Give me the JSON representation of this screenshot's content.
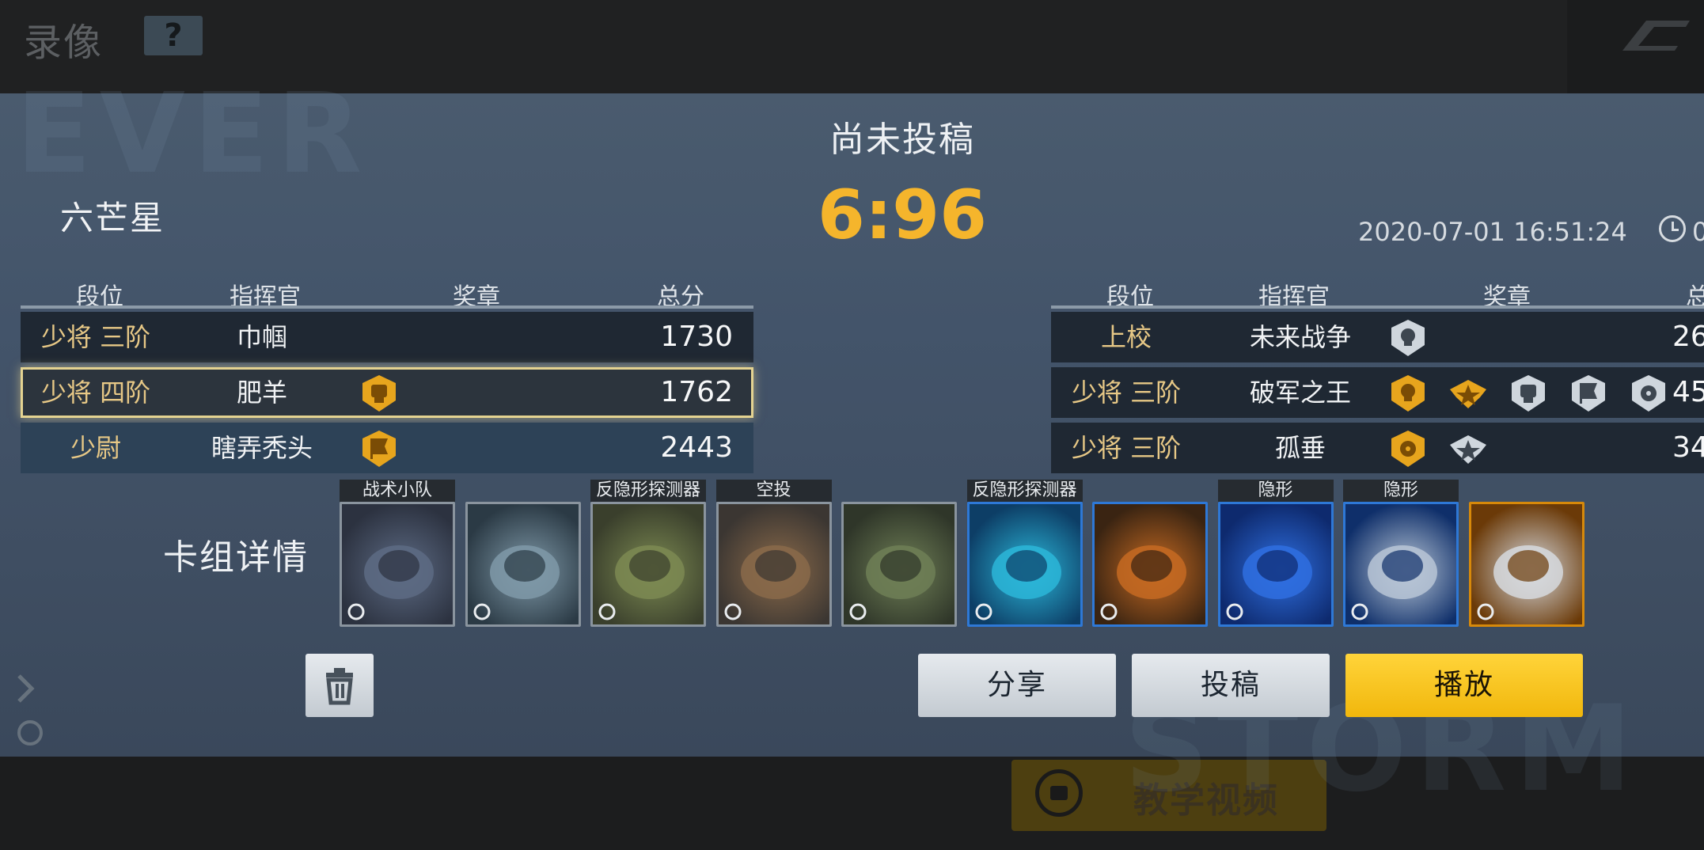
{
  "header": {
    "title": "录像",
    "help_label": "?"
  },
  "tutorial": {
    "label": "教学视频"
  },
  "replay": {
    "status": "尚未投稿",
    "score": "6:96",
    "team_left": "六芒星",
    "datetime": "2020-07-01 16:51:24",
    "duration_fragment": "0"
  },
  "table_headers": {
    "rank": "段位",
    "commander": "指挥官",
    "medals": "奖章",
    "total": "总分"
  },
  "left_team": [
    {
      "rank": "少将 三阶",
      "commander": "巾帼",
      "medals": [],
      "total": "1730",
      "style": "normal"
    },
    {
      "rank": "少将 四阶",
      "commander": "肥羊",
      "medals": [
        "gold-fist-medal-icon"
      ],
      "total": "1762",
      "style": "highlight"
    },
    {
      "rank": "少尉",
      "commander": "瞎弄秃头",
      "medals": [
        "gold-flag-medal-icon"
      ],
      "total": "2443",
      "style": "blue"
    }
  ],
  "right_team": [
    {
      "rank": "上校",
      "commander": "未来战争",
      "medals": [
        "silver-skull-medal-icon"
      ],
      "total_partial": "26"
    },
    {
      "rank": "少将 三阶",
      "commander": "破军之王",
      "medals": [
        "gold-skull-medal-icon",
        "gold-wings-medal-icon",
        "silver-fist-medal-icon",
        "silver-flag-medal-icon",
        "silver-radiation-medal-icon"
      ],
      "total_partial": "45"
    },
    {
      "rank": "少将 三阶",
      "commander": "孤垂",
      "medals": [
        "gold-radiation-medal-icon",
        "silver-wings-medal-icon"
      ],
      "total_partial": "34"
    }
  ],
  "deck": {
    "label": "卡组详情",
    "cards": [
      {
        "tag": "战术小队",
        "icon": "infantry-squad-card-icon",
        "border": "gray",
        "colors": [
          "#2c3240",
          "#5d6b84"
        ]
      },
      {
        "tag": "",
        "icon": "mech-pod-card-icon",
        "border": "gray",
        "colors": [
          "#2b3a45",
          "#7f99a8"
        ]
      },
      {
        "tag": "反隐形探测器",
        "icon": "green-walker-card-icon",
        "border": "gray",
        "colors": [
          "#3a3f2c",
          "#7c8a52"
        ]
      },
      {
        "tag": "空投",
        "icon": "missile-turret-card-icon",
        "border": "gray",
        "colors": [
          "#3b3632",
          "#8a6a4a"
        ]
      },
      {
        "tag": "",
        "icon": "green-tank-card-icon",
        "border": "gray",
        "colors": [
          "#2f3629",
          "#6f7f56"
        ]
      },
      {
        "tag": "反隐形探测器",
        "icon": "cyan-drone-card-icon",
        "border": "blue",
        "colors": [
          "#0d3e66",
          "#2bb6d8"
        ]
      },
      {
        "tag": "",
        "icon": "battle-explosion-card-icon",
        "border": "blue",
        "colors": [
          "#3a2412",
          "#c56a22"
        ]
      },
      {
        "tag": "隐形",
        "icon": "stealth-jet-card-icon",
        "border": "blue",
        "colors": [
          "#0e2a6e",
          "#2f6fe0"
        ]
      },
      {
        "tag": "隐形",
        "icon": "white-hover-tank-card-icon",
        "border": "blue",
        "colors": [
          "#0f2f6a",
          "#b8c6d6"
        ]
      },
      {
        "tag": "",
        "icon": "gold-hover-craft-card-icon",
        "border": "gold",
        "colors": [
          "#6b3a08",
          "#d6d9de"
        ]
      }
    ]
  },
  "buttons": {
    "share": "分享",
    "submit": "投稿",
    "play": "播放"
  }
}
